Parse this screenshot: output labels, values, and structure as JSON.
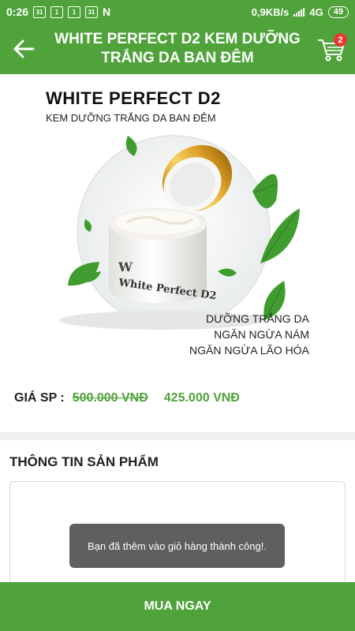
{
  "status_bar": {
    "time": "0:26",
    "icons": [
      "31",
      "1",
      "1",
      "31",
      "N"
    ],
    "speed": "0,9KB/s",
    "network": "4G",
    "battery": "49"
  },
  "app_bar": {
    "title": "WHITE PERFECT D2 KEM DƯỠNG\nTRẮNG DA BAN ĐÊM",
    "cart_count": "2",
    "back_icon": "arrow-left-icon",
    "cart_icon": "shopping-cart-icon"
  },
  "product_image": {
    "brand": "WHITE PERFECT D2",
    "subtitle": "KEM DƯỠNG TRẮNG DA BAN ĐÊM",
    "jar_label": "White Perfect D2",
    "benefits": [
      "DƯỠNG TRẮNG DA",
      "NGĂN NGỪA NÁM",
      "NGĂN NGỪA LÃO HÓA"
    ]
  },
  "price": {
    "label": "GIÁ SP :",
    "old": "500.000 VNĐ",
    "new": "425.000 VNĐ"
  },
  "info_section": {
    "title": "THÔNG TIN SẢN PHẨM"
  },
  "toast": {
    "message": "Bạn đã thêm vào giỏ hàng thành công!."
  },
  "buy_button": {
    "label": "MUA NGAY"
  },
  "colors": {
    "primary": "#4fa33a",
    "badge": "#e53935",
    "toast": "#5f5f5f"
  }
}
